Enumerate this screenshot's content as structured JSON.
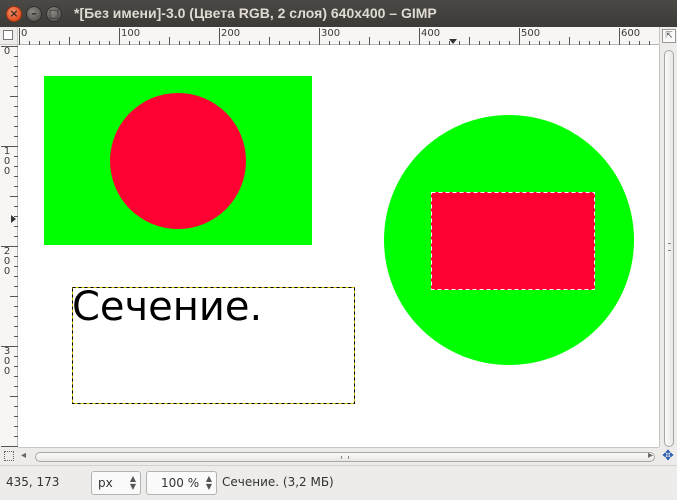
{
  "window": {
    "title": "*[Без имени]-3.0 (Цвета RGB, 2 слоя) 640x400 – GIMP",
    "close_glyph": "×",
    "min_glyph": "–",
    "max_glyph": "□"
  },
  "rulers": {
    "horizontal_labels": [
      "0",
      "100",
      "200",
      "300",
      "400",
      "500",
      "600"
    ],
    "vertical_labels": [
      [
        "0"
      ],
      [
        "1",
        "0",
        "0"
      ],
      [
        "2",
        "0",
        "0"
      ],
      [
        "3",
        "0",
        "0"
      ]
    ]
  },
  "canvas": {
    "text_layer": "Сечение.",
    "colors": {
      "green": "#00ff00",
      "red": "#ff0033",
      "background": "#ffffff"
    }
  },
  "statusbar": {
    "pointer_coords": "435, 173",
    "unit": "px",
    "zoom": "100 %",
    "message": "Сечение. (3,2 МБ)"
  },
  "icons": {
    "quick_mask": "quick-mask-icon",
    "navigate": "navigate-icon",
    "zoom_toggle": "zoom-toggle-icon"
  }
}
